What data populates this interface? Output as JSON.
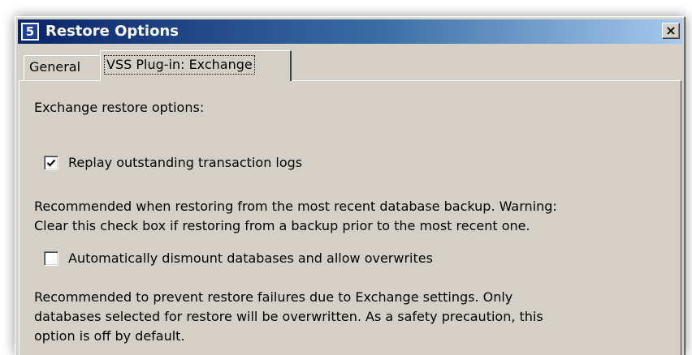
{
  "window": {
    "title": "Restore Options",
    "icon_glyph": "5",
    "close_glyph": "×"
  },
  "tabs": [
    {
      "label": "General",
      "selected": false
    },
    {
      "label": "VSS Plug-in: Exchange",
      "selected": true
    }
  ],
  "panel": {
    "section_label": "Exchange restore options:",
    "options": [
      {
        "label": "Replay outstanding transaction logs",
        "checked": true,
        "description_lines": [
          "Recommended when restoring from the most recent database backup. Warning:",
          "Clear this check box if restoring from a backup prior to the most recent one."
        ]
      },
      {
        "label": "Automatically dismount databases and allow overwrites",
        "checked": false,
        "description_lines": [
          "Recommended to prevent restore failures due to Exchange settings. Only",
          "databases selected for restore will be overwritten. As a safety precaution, this",
          "option is off by default."
        ]
      }
    ]
  },
  "colors": {
    "titlebar_start": "#0a246a",
    "titlebar_end": "#a6caf0",
    "dialog_face": "#d4d0c8"
  }
}
